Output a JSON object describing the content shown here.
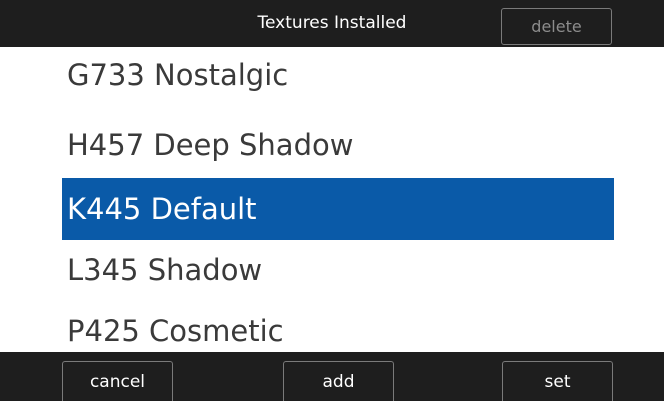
{
  "header": {
    "title": "Textures Installed",
    "delete_label": "delete"
  },
  "list": {
    "items": [
      {
        "label": "G733 Nostalgic",
        "selected": false
      },
      {
        "label": "H457 Deep Shadow",
        "selected": false
      },
      {
        "label": "K445 Default",
        "selected": true
      },
      {
        "label": "L345 Shadow",
        "selected": false
      },
      {
        "label": "P425 Cosmetic",
        "selected": false
      }
    ]
  },
  "footer": {
    "cancel_label": "cancel",
    "add_label": "add",
    "set_label": "set"
  },
  "colors": {
    "bar_background": "#1e1e1e",
    "list_background": "#ffffff",
    "selection": "#0a5aa8",
    "disabled_text": "#8c8c8c"
  }
}
